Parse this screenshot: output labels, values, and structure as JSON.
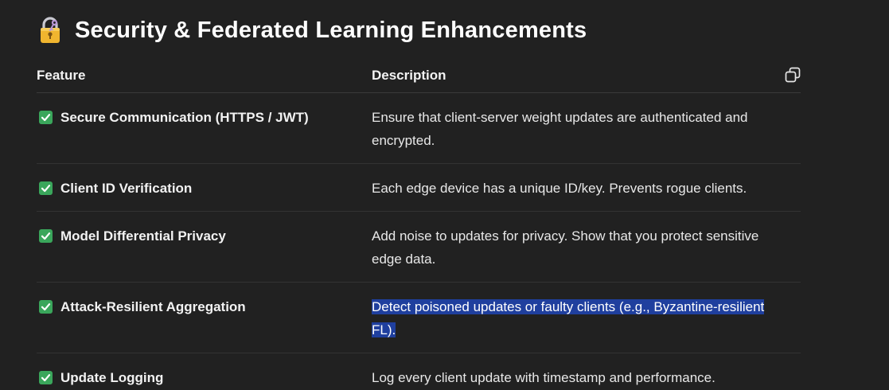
{
  "section": {
    "title": "Security & Federated Learning Enhancements",
    "icon": "locked-with-key-icon"
  },
  "table": {
    "headers": {
      "feature": "Feature",
      "description": "Description"
    },
    "copy_icon": "copy-icon",
    "rows": [
      {
        "feature": "Secure Communication (HTTPS / JWT)",
        "description": "Ensure that client-server weight updates are authenticated and encrypted.",
        "highlighted": false
      },
      {
        "feature": "Client ID Verification",
        "description": "Each edge device has a unique ID/key. Prevents rogue clients.",
        "highlighted": false
      },
      {
        "feature": "Model Differential Privacy",
        "description": "Add noise to updates for privacy. Show that you protect sensitive edge data.",
        "highlighted": false
      },
      {
        "feature": "Attack-Resilient Aggregation",
        "description": "Detect poisoned updates or faulty clients (e.g., Byzantine-resilient FL).",
        "highlighted": true
      },
      {
        "feature": "Update Logging",
        "description": "Log every client update with timestamp and performance.",
        "highlighted": false
      }
    ]
  },
  "colors": {
    "background": "#212121",
    "check": "#3aa65b",
    "selection": "#1f3f9e"
  }
}
